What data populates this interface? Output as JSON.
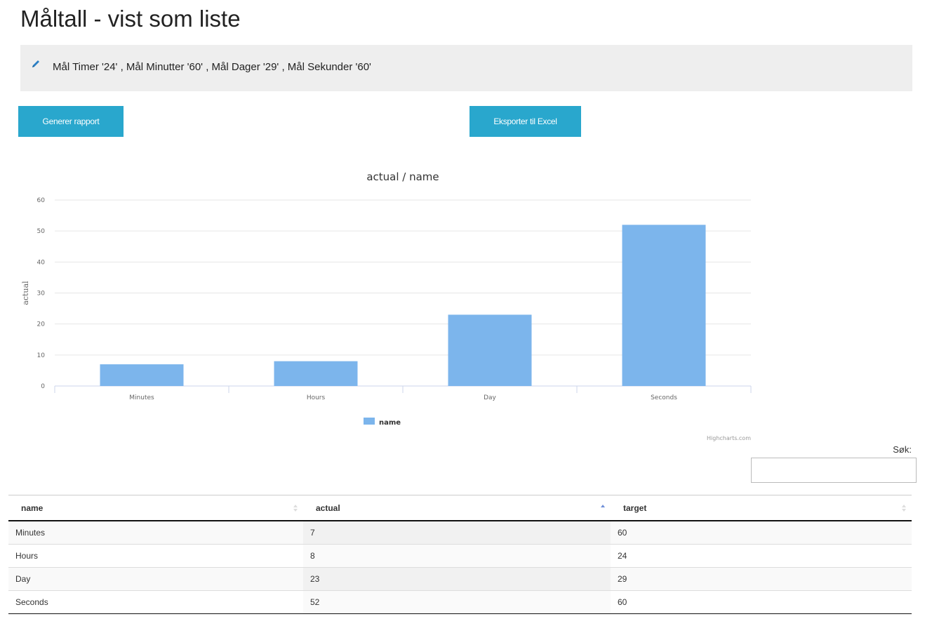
{
  "page": {
    "title": "Måltall - vist som liste"
  },
  "filter": {
    "icon": "pencil-icon",
    "text": "Mål Timer '24' , Mål Minutter '60' , Mål Dager '29' , Mål Sekunder '60'"
  },
  "toolbar": {
    "report_label": "Generer rapport",
    "excel_label": "Eksporter til Excel"
  },
  "chart_data": {
    "type": "bar",
    "title": "actual / name",
    "xlabel": "",
    "ylabel": "actual",
    "categories": [
      "Minutes",
      "Hours",
      "Day",
      "Seconds"
    ],
    "series": [
      {
        "name": "name",
        "values": [
          7,
          8,
          23,
          52
        ],
        "color": "#7cb5ec"
      }
    ],
    "ylim": [
      0,
      60
    ],
    "yticks": [
      0,
      10,
      20,
      30,
      40,
      50,
      60
    ],
    "grid": true,
    "legend": "bottom-center",
    "credits": "Highcharts.com"
  },
  "search": {
    "label": "Søk:",
    "value": ""
  },
  "table": {
    "columns": [
      "name",
      "actual",
      "target"
    ],
    "sorted_column": "actual",
    "sort_direction": "ascending",
    "rows": [
      [
        "Minutes",
        "7",
        "60"
      ],
      [
        "Hours",
        "8",
        "24"
      ],
      [
        "Day",
        "23",
        "29"
      ],
      [
        "Seconds",
        "52",
        "60"
      ]
    ]
  },
  "colors": {
    "button": "#29a7cd",
    "bar": "#7cb5ec",
    "filter_bg": "#eeeeee",
    "sort_active": "#6f8fd8"
  }
}
